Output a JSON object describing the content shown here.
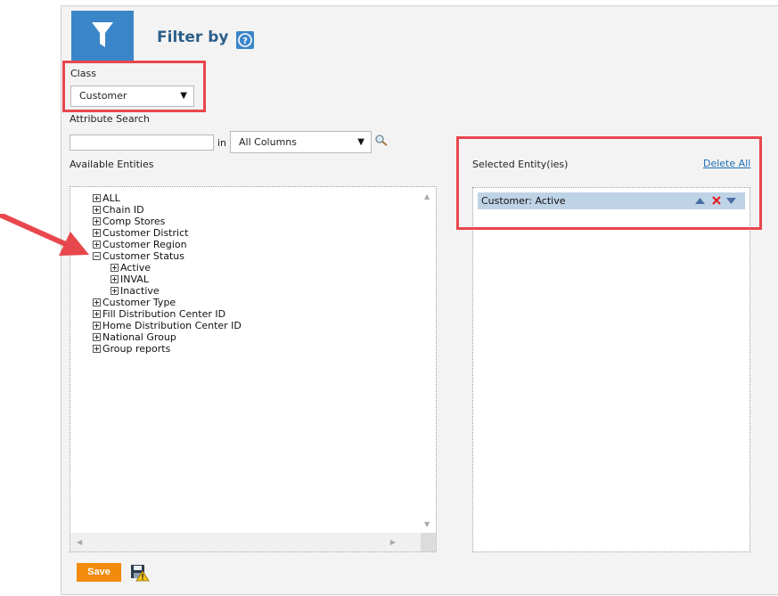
{
  "header": {
    "title": "Filter by",
    "filter_icon": "funnel-icon",
    "help_icon": "question-icon"
  },
  "class_filter": {
    "label": "Class",
    "selected": "Customer"
  },
  "attribute_search": {
    "label": "Attribute Search",
    "value": "",
    "in_label": "in",
    "column_selected": "All Columns"
  },
  "available": {
    "label": "Available Entities",
    "items": [
      {
        "label": "ALL",
        "state": "collapsed"
      },
      {
        "label": "Chain ID",
        "state": "collapsed"
      },
      {
        "label": "Comp Stores",
        "state": "collapsed"
      },
      {
        "label": "Customer District",
        "state": "collapsed"
      },
      {
        "label": "Customer Region",
        "state": "collapsed"
      },
      {
        "label": "Customer Status",
        "state": "expanded"
      },
      {
        "label": "Active",
        "state": "collapsed",
        "child": true
      },
      {
        "label": "INVAL",
        "state": "collapsed",
        "child": true
      },
      {
        "label": "Inactive",
        "state": "collapsed",
        "child": true
      },
      {
        "label": "Customer Type",
        "state": "collapsed"
      },
      {
        "label": "Fill Distribution Center ID",
        "state": "collapsed"
      },
      {
        "label": "Home Distribution Center ID",
        "state": "collapsed"
      },
      {
        "label": "National Group",
        "state": "collapsed"
      },
      {
        "label": "Group reports",
        "state": "collapsed"
      }
    ]
  },
  "selected": {
    "label": "Selected Entity(ies)",
    "delete_all": "Delete All",
    "items": [
      {
        "label": "Customer: Active"
      }
    ]
  },
  "footer": {
    "save_label": "Save"
  },
  "colors": {
    "accent": "#3b86c8",
    "save": "#f28a0b",
    "highlight": "#e8474d",
    "selected_row": "#bfd3e6",
    "link": "#1f6fb3"
  }
}
